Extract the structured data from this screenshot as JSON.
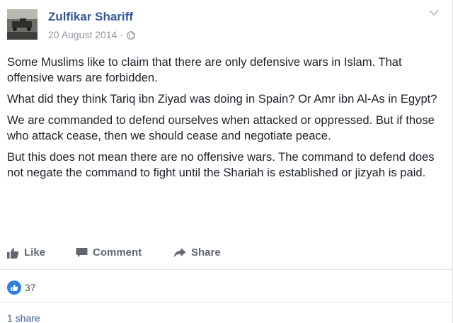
{
  "post": {
    "author": "Zulfikar Shariff",
    "date": "20 August 2014",
    "separator": "·",
    "paragraphs": [
      "Some Muslims like to claim that there are only defensive wars in Islam. That offensive wars are forbidden.",
      "What did they think Tariq ibn Ziyad was doing in Spain? Or Amr ibn Al-As in Egypt?",
      "We are commanded to defend ourselves when attacked or oppressed. But if those who attack cease, then we should cease and negotiate peace.",
      "But this does not mean there are no offensive wars. The command to defend does not negate the command to fight until the Shariah is established or jizyah is paid."
    ]
  },
  "actions": {
    "like_label": "Like",
    "comment_label": "Comment",
    "share_label": "Share"
  },
  "reactions": {
    "like_count": "37"
  },
  "shares": {
    "label": "1 share"
  },
  "colors": {
    "author_link": "#365899",
    "meta_text": "#90949c",
    "action_text": "#606770",
    "like_badge": "#2f7de1"
  },
  "icons": {
    "visibility": "globe-icon",
    "menu": "chevron-down-icon",
    "like": "thumbs-up-icon",
    "comment": "comment-bubble-icon",
    "share": "share-arrow-icon"
  }
}
